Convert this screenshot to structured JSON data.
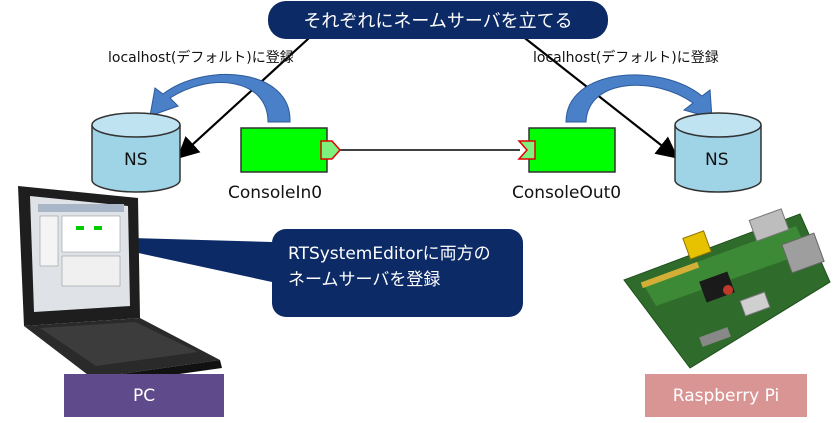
{
  "title": "それぞれにネームサーバを立てる",
  "register_note_left": "localhost(デフォルト)に登録",
  "register_note_right": "localhost(デフォルト)に登録",
  "ns_left": "NS",
  "ns_right": "NS",
  "component_in": "ConsoleIn0",
  "component_out": "ConsoleOut0",
  "callout_line1": "RTSystemEditorに両方の",
  "callout_line2": "ネームサーバを登録",
  "pc_label": "PC",
  "pi_label": "Raspberry Pi",
  "colors": {
    "pill_bg": "#0b2a66",
    "component_fill": "#00ff00",
    "port_fill": "#7ef07e",
    "port_stroke": "#e00000",
    "ns_fill": "#9fd3e6",
    "arrow_fill": "#4a80c8",
    "pc_box": "#5f4b8b",
    "pi_box": "#d99594"
  }
}
